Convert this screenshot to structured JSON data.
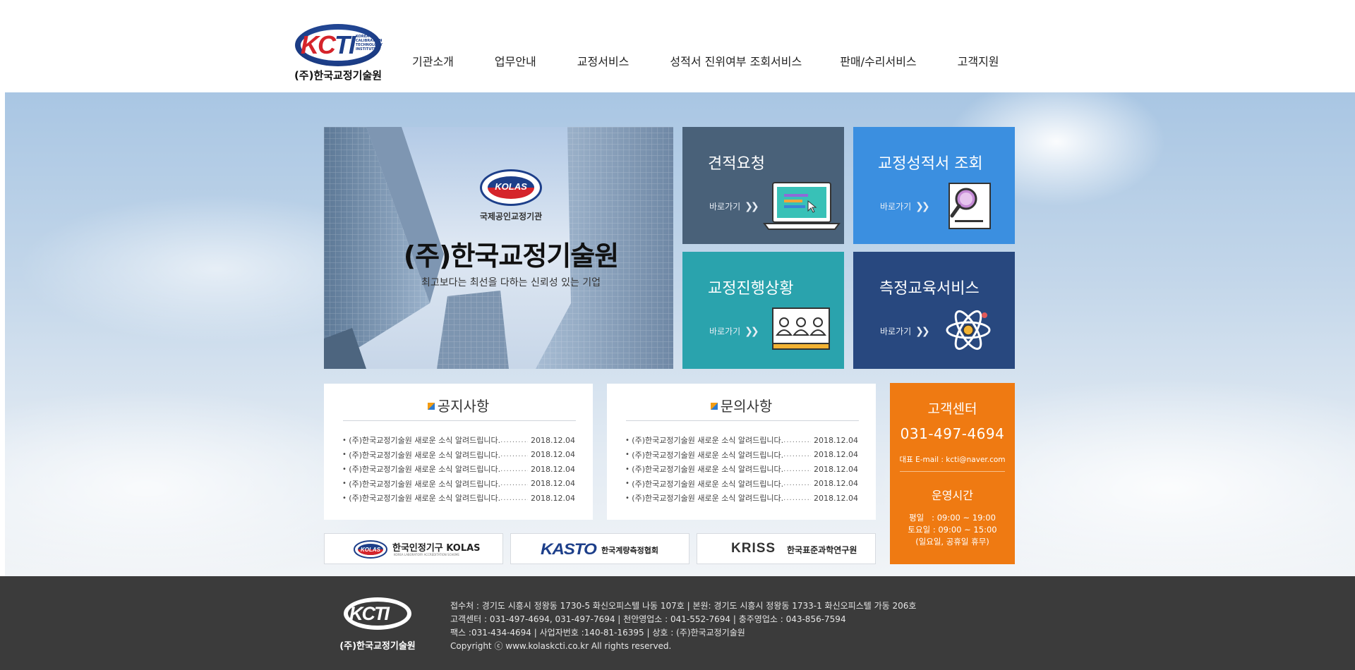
{
  "header": {
    "logo_text": "(주)한국교정기술원",
    "logo_letters": "KCTI",
    "logo_sub": "KOREA CALIBRATION TECHNOLOGY INSTITUTE",
    "nav": [
      "기관소개",
      "업무안내",
      "교정서비스",
      "성적서 진위여부 조회서비스",
      "판매/수리서비스",
      "고객지원"
    ]
  },
  "banner": {
    "emblem_text": "KOLAS",
    "tag": "국제공인교정기관",
    "title": "(주)한국교정기술원",
    "subtitle": "최고보다는 최선을 다하는 신뢰성 있는 기업"
  },
  "tiles": [
    {
      "title": "견적요청",
      "link": "바로가기",
      "icon": "laptop-icon",
      "color": "#496179"
    },
    {
      "title": "교정성적서 조회",
      "link": "바로가기",
      "icon": "search-document-icon",
      "color": "#3b8fe0"
    },
    {
      "title": "교정진행상황",
      "link": "바로가기",
      "icon": "classroom-icon",
      "color": "#2aa3ad"
    },
    {
      "title": "측정교육서비스",
      "link": "바로가기",
      "icon": "atom-icon",
      "color": "#28487f"
    }
  ],
  "notice": {
    "title": "공지사항",
    "items": [
      {
        "title": "(주)한국교정기술원 새로운 소식 알려드립니다.",
        "date": "2018.12.04"
      },
      {
        "title": "(주)한국교정기술원 새로운 소식 알려드립니다.",
        "date": "2018.12.04"
      },
      {
        "title": "(주)한국교정기술원 새로운 소식 알려드립니다.",
        "date": "2018.12.04"
      },
      {
        "title": "(주)한국교정기술원 새로운 소식 알려드립니다.",
        "date": "2018.12.04"
      },
      {
        "title": "(주)한국교정기술원 새로운 소식 알려드립니다.",
        "date": "2018.12.04"
      }
    ]
  },
  "inquiry": {
    "title": "문의사항",
    "items": [
      {
        "title": "(주)한국교정기술원 새로운 소식 알려드립니다.",
        "date": "2018.12.04"
      },
      {
        "title": "(주)한국교정기술원 새로운 소식 알려드립니다.",
        "date": "2018.12.04"
      },
      {
        "title": "(주)한국교정기술원 새로운 소식 알려드립니다.",
        "date": "2018.12.04"
      },
      {
        "title": "(주)한국교정기술원 새로운 소식 알려드립니다.",
        "date": "2018.12.04"
      },
      {
        "title": "(주)한국교정기술원 새로운 소식 알려드립니다.",
        "date": "2018.12.04"
      }
    ]
  },
  "customer_center": {
    "title": "고객센터",
    "phone": "031-497-4694",
    "email": "대표 E-mail : kcti@naver.com",
    "hours_title": "운영시간",
    "weekday": "평일   : 09:00 ~ 19:00",
    "saturday": "토요일 : 09:00 ~ 15:00",
    "holiday": "(일요일, 공휴일 휴무)",
    "color": "#ef7a12"
  },
  "partners": [
    {
      "name": "한국인정기구 KOLAS",
      "mark": "KOLAS",
      "sub": "KOREA LABORATORY ACCREDITATION SCHEME"
    },
    {
      "name": "한국계량측정협회",
      "mark": "KASTO"
    },
    {
      "name": "한국표준과학연구원",
      "mark": "KRISS"
    }
  ],
  "footer": {
    "logo_letters": "KCTI",
    "logo_text": "(주)한국교정기술원",
    "lines": [
      "접수처 : 경기도 시흥시 정왕동 1730-5 화신오피스텔 나동 107호 | 본원: 경기도 시흥시 정왕동 1733-1 화신오피스텔 가동 206호",
      "고객센터 : 031-497-4694, 031-497-7694 | 천안영업소 : 041-552-7694 | 충주영업소 : 043-856-7594",
      "팩스 :031-434-4694 | 사업자번호 :140-81-16395 | 상호 : (주)한국교정기술원",
      "Copyright ⓒ www.kolaskcti.co.kr All rights reserved."
    ]
  }
}
